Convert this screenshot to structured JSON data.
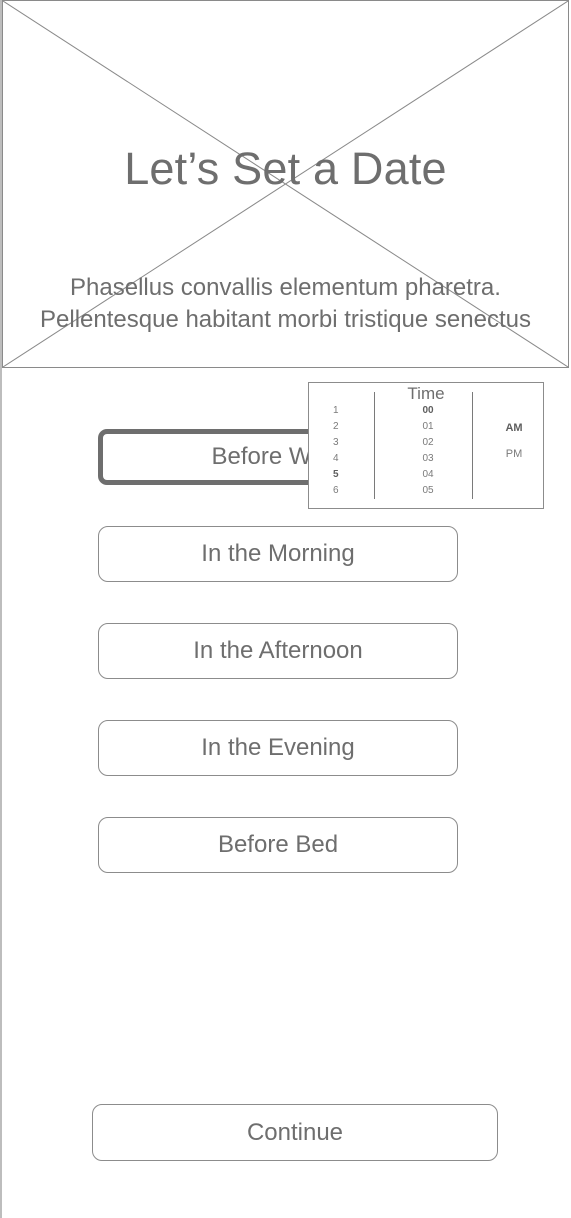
{
  "hero": {
    "title": "Let’s Set a Date",
    "subtitle_line1": "Phasellus convallis elementum pharetra.",
    "subtitle_line2": "Pellentesque habitant morbi tristique senectus"
  },
  "options": [
    {
      "label": "Before Work",
      "selected": true
    },
    {
      "label": "In the Morning",
      "selected": false
    },
    {
      "label": "In the Afternoon",
      "selected": false
    },
    {
      "label": "In the Evening",
      "selected": false
    },
    {
      "label": "Before Bed",
      "selected": false
    }
  ],
  "time_picker": {
    "title": "Time",
    "hours": [
      "1",
      "2",
      "3",
      "4",
      "5",
      "6"
    ],
    "selected_hour": "5",
    "minutes": [
      "00",
      "01",
      "02",
      "03",
      "04",
      "05"
    ],
    "selected_minute": "00",
    "periods": [
      "AM",
      "PM"
    ],
    "selected_period": "AM"
  },
  "continue_label": "Continue",
  "colors": {
    "text": "#6e6e6e",
    "border": "#8c8c8c",
    "background": "#ffffff"
  }
}
